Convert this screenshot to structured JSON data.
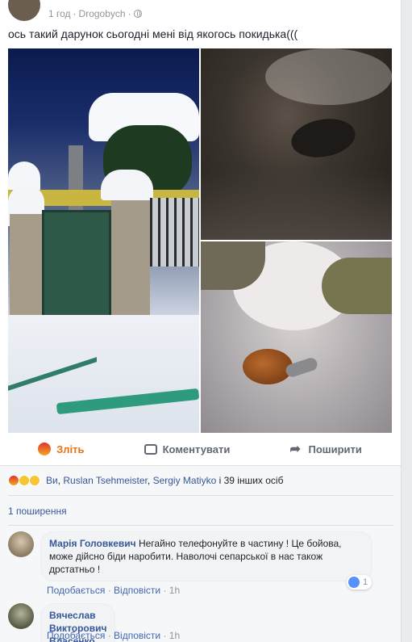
{
  "post": {
    "time": "1 год",
    "location": "Drogobych",
    "text": "ось такий дарунок сьогодні мені від якогось покидька((("
  },
  "actions": {
    "angry_label": "Зліть",
    "comment_label": "Коментувати",
    "share_label": "Поширити"
  },
  "reactions": {
    "you": "Ви",
    "name1": "Ruslan Tsehmeister",
    "name2": "Sergiy Matiyko",
    "others": "і 39 інших осіб"
  },
  "shares_text": "1 поширення",
  "comments": [
    {
      "author": "Марія Головкевич",
      "text": "Негайно телефонуйте в частину ! Це бойова, може дійсно біди наробити. Наволочі сепарської в нас також дрстатньо !",
      "like": "Подобається",
      "reply": "Відповісти",
      "time": "1h",
      "likes_count": "1"
    },
    {
      "author": "Вячеслав Викторович Власенко",
      "text": "???",
      "like": "Подобається",
      "reply": "Відповісти",
      "time": "1h"
    }
  ],
  "colors": {
    "link": "#365899",
    "angry_accent": "#e9710f",
    "meta_gray": "#90949c"
  }
}
